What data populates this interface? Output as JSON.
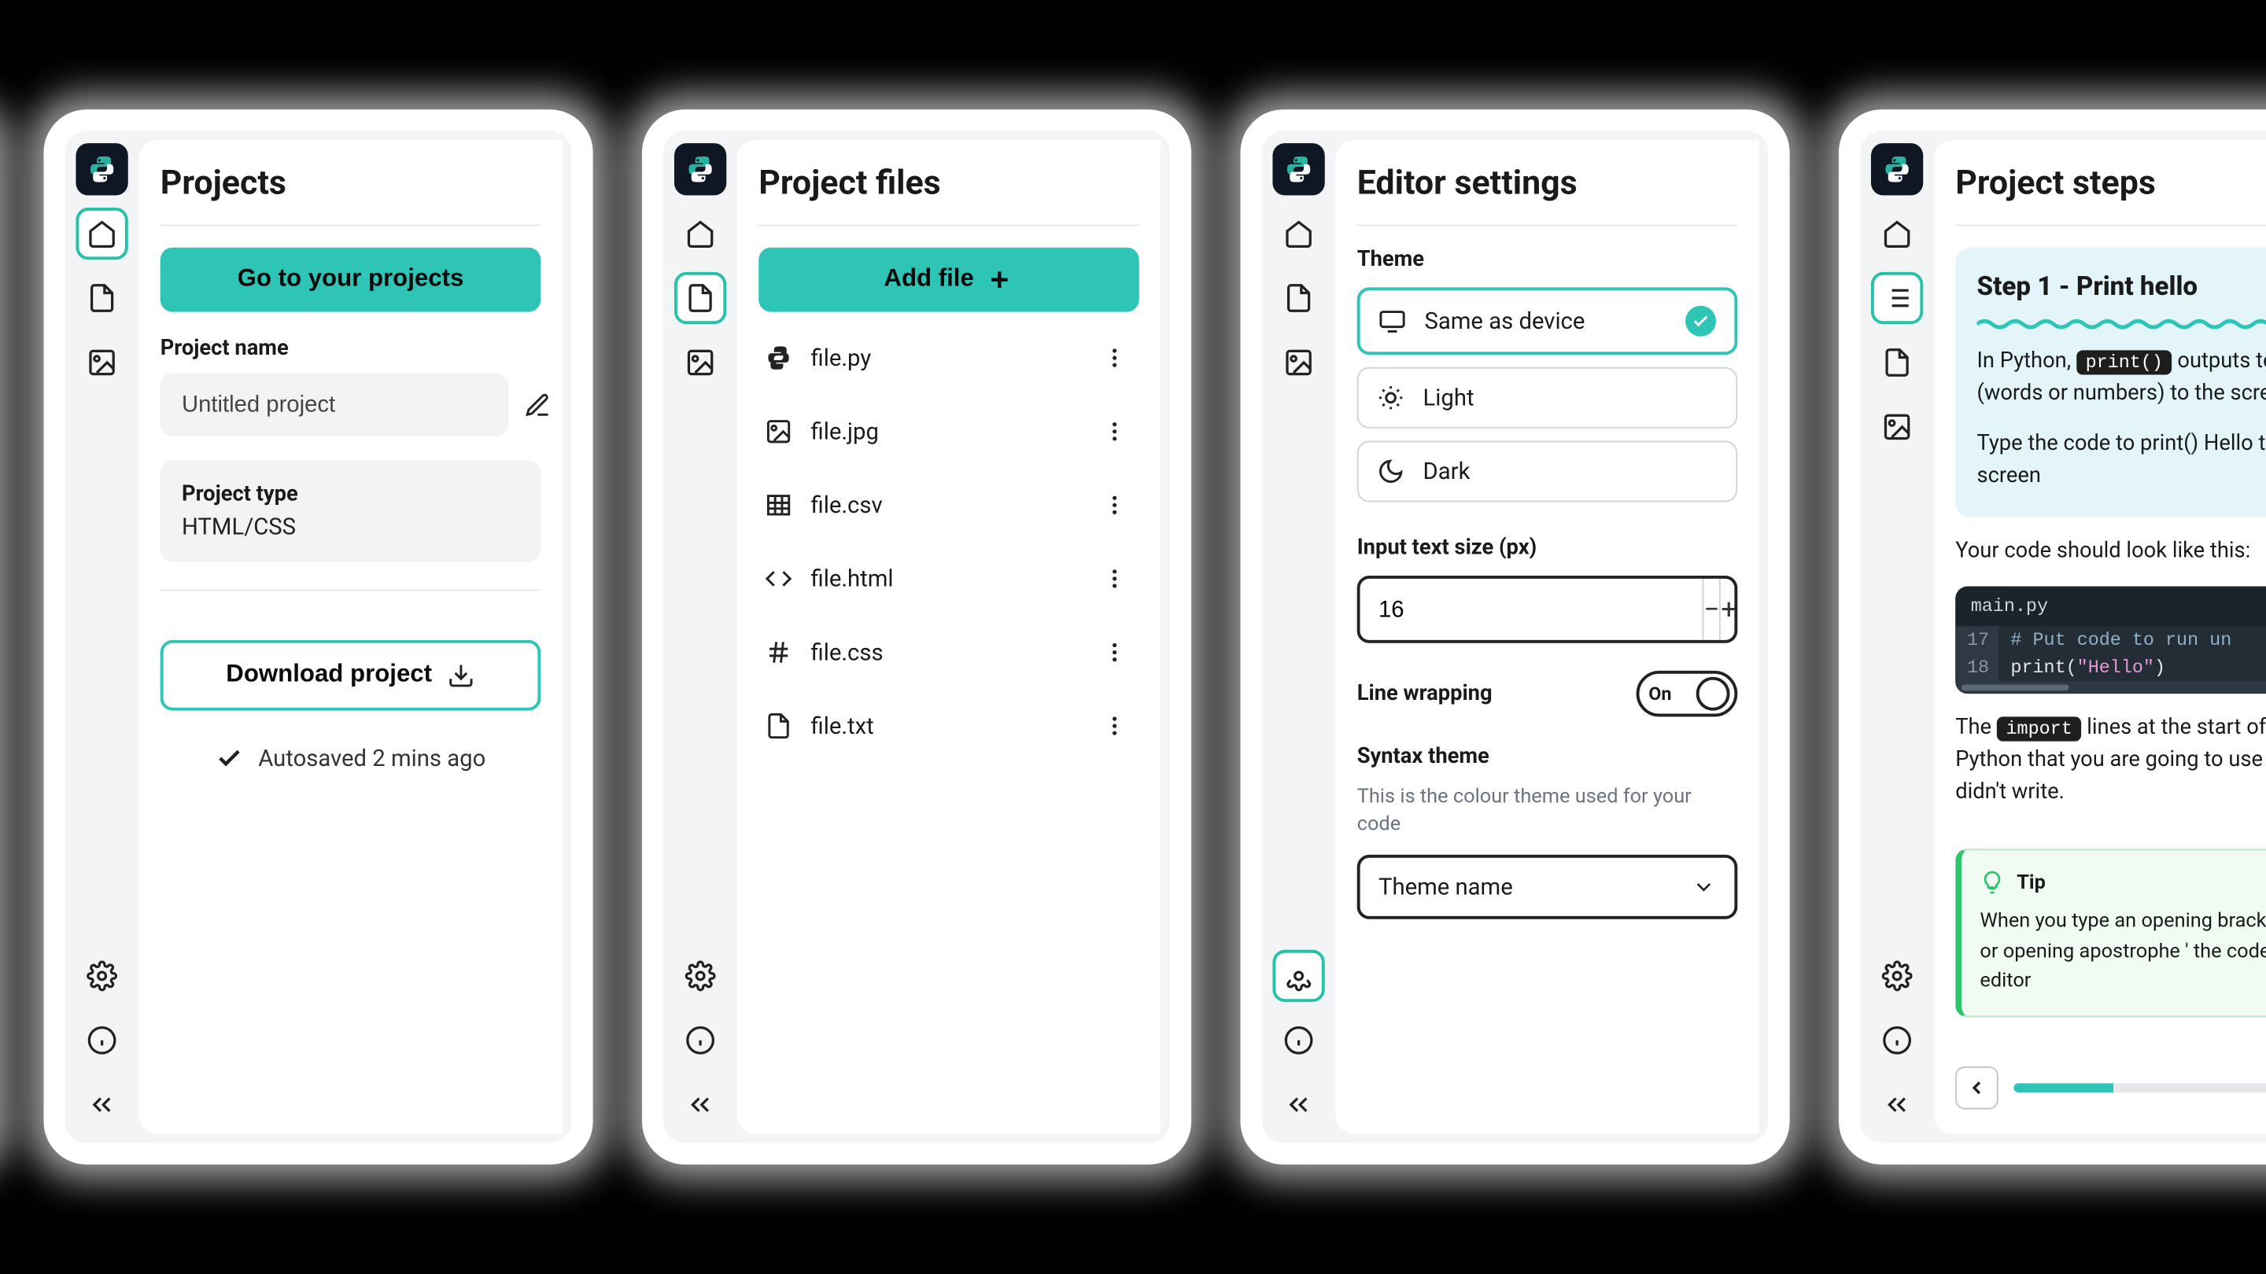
{
  "panels": {
    "projects": {
      "title": "Projects",
      "go_button": "Go to your projects",
      "name_label": "Project name",
      "name_value": "Untitled project",
      "type_label": "Project type",
      "type_value": "HTML/CSS",
      "download_label": "Download project",
      "autosaved": "Autosaved 2 mins ago"
    },
    "files": {
      "title": "Project files",
      "add_button": "Add file",
      "items": [
        {
          "name": "file.py",
          "icon": "python"
        },
        {
          "name": "file.jpg",
          "icon": "image"
        },
        {
          "name": "file.csv",
          "icon": "table"
        },
        {
          "name": "file.html",
          "icon": "code"
        },
        {
          "name": "file.css",
          "icon": "hash"
        },
        {
          "name": "file.txt",
          "icon": "doc"
        }
      ]
    },
    "settings": {
      "title": "Editor settings",
      "theme_label": "Theme",
      "theme_options": {
        "device": "Same as device",
        "light": "Light",
        "dark": "Dark"
      },
      "text_size_label": "Input text size (px)",
      "text_size_value": "16",
      "wrap_label": "Line wrapping",
      "wrap_value": "On",
      "syntax_label": "Syntax theme",
      "syntax_desc": "This is the colour theme used for your code",
      "syntax_placeholder": "Theme name"
    },
    "steps": {
      "title": "Project steps",
      "step_heading": "Step 1 - Print hello",
      "intro_pre": "In Python, ",
      "intro_code": "print()",
      "intro_post": " outputs text (words or numbers) to the screen.",
      "instruction": "Type the code to print() Hello to the screen",
      "look_like": "Your code should look like this:",
      "code_tab": "main.py",
      "code_lines": [
        {
          "ln": "17",
          "text": "# Put code to run un",
          "cls": "comment"
        },
        {
          "ln": "18",
          "text_pre": "print(",
          "text_str": "\"Hello\"",
          "text_post": ")"
        }
      ],
      "import_pre": "The ",
      "import_code": "import",
      "import_post": " lines at the start of tell Python that you are going to use you didn't write.",
      "tip_title": "Tip",
      "tip_body": "When you type an opening bracket ( or opening apostrophe ' the code editor"
    }
  }
}
